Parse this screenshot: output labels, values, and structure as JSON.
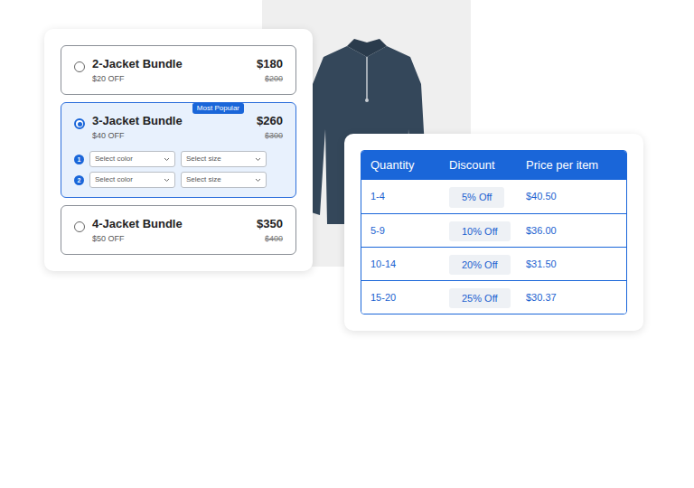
{
  "bundles": [
    {
      "title": "2-Jacket Bundle",
      "discount": "$20 OFF",
      "price": "$180",
      "original_price": "$200",
      "selected": false
    },
    {
      "title": "3-Jacket Bundle",
      "discount": "$40 OFF",
      "price": "$260",
      "original_price": "$300",
      "selected": true,
      "badge": "Most Popular",
      "variants": [
        {
          "number": "1",
          "color_placeholder": "Select color",
          "size_placeholder": "Select size"
        },
        {
          "number": "2",
          "color_placeholder": "Select color",
          "size_placeholder": "Select size"
        }
      ]
    },
    {
      "title": "4-Jacket Bundle",
      "discount": "$50 OFF",
      "price": "$350",
      "original_price": "$400",
      "selected": false
    }
  ],
  "pricing_table": {
    "columns": [
      "Quantity",
      "Discount",
      "Price per item"
    ],
    "rows": [
      [
        "1-4",
        "5% Off",
        "$40.50"
      ],
      [
        "5-9",
        "10% Off",
        "$36.00"
      ],
      [
        "10-14",
        "20% Off",
        "$31.50"
      ],
      [
        "15-20",
        "25% Off",
        "$30.37"
      ]
    ]
  }
}
